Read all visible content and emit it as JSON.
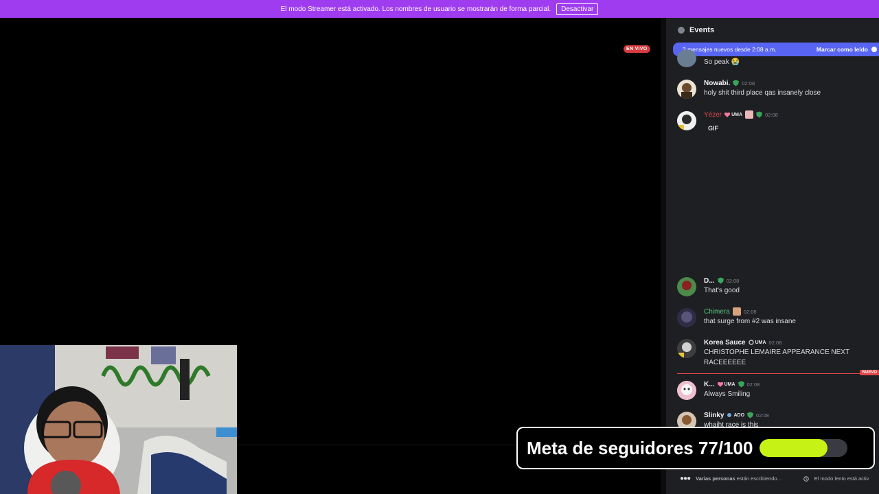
{
  "banner": {
    "text": "El modo Streamer está activado. Los nombres de usuario se mostrarán de forma parcial.",
    "button_label": "Desactivar"
  },
  "stream": {
    "live_badge": "EN VIVO"
  },
  "chat": {
    "header_title": "Events",
    "new_messages": {
      "text": "3 mensajes nuevos desde 2:08 a.m.",
      "mark_read_label": "Marcar como leído"
    },
    "messages": [
      {
        "username": "",
        "time": "",
        "text": "So peak 😭"
      },
      {
        "username": "Nowabi.",
        "time": "02:08",
        "text": "holy shit third place qas insanely close"
      },
      {
        "username": "Yézer",
        "badge": "UMA",
        "time": "02:08",
        "text": "GIF"
      },
      {
        "username": "D...",
        "time": "02:08",
        "text": "That's good"
      },
      {
        "username": "Chimera",
        "time": "02:08",
        "text": "that surge from #2 was insane"
      },
      {
        "username": "Korea Sauce",
        "badge": "UMA",
        "time": "02:08",
        "text": "CHRISTOPHE LEMAIRE APPEARANCE NEXT RACEEEEEE"
      },
      {
        "username": "K...",
        "badge": "UMA",
        "time": "02:08",
        "text": "Always Smiling"
      },
      {
        "username": "Slinky",
        "badge": "ADO",
        "time": "02:08",
        "text": "whaiht race is this"
      }
    ],
    "new_divider_label": "NUEVO",
    "typing": {
      "who": "Varias personas",
      "suffix": " están escribiendo...",
      "slowmode": "El modo lento está activ"
    }
  },
  "goal": {
    "label": "Meta de seguidores 77/100",
    "current": 77,
    "target": 100
  },
  "colors": {
    "banner": "#a03cf0",
    "accent_bar": "#5865f2",
    "goal_fill": "#c6f215",
    "live": "#d83c3e",
    "chat_bg": "#1e1f22"
  }
}
